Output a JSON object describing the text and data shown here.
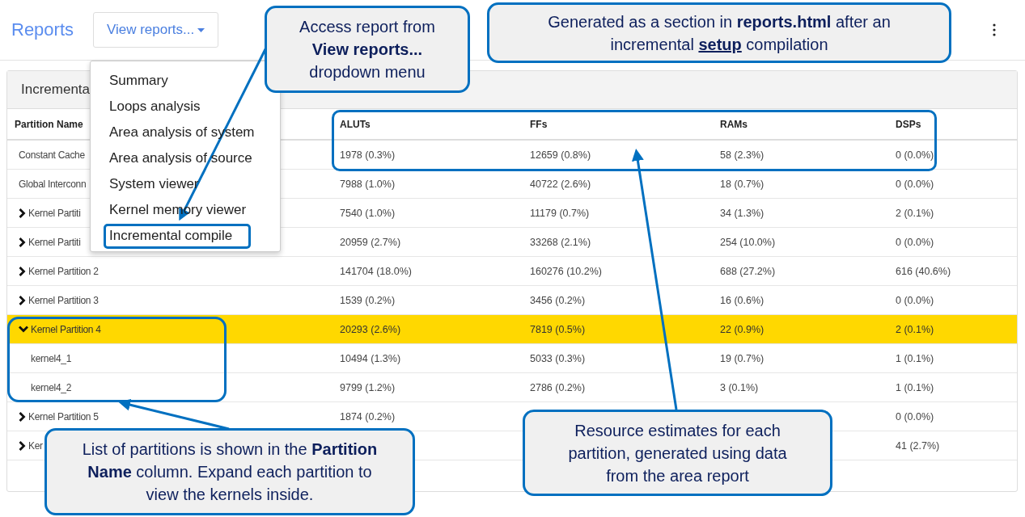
{
  "header": {
    "title": "Reports",
    "view_button": "View reports..."
  },
  "dropdown": {
    "items": [
      "Summary",
      "Loops analysis",
      "Area analysis of system",
      "Area analysis of source",
      "System viewer",
      "Kernel memory viewer",
      "Incremental compile"
    ]
  },
  "panel": {
    "title": "Incrementa",
    "columns": [
      "Partition Name",
      "ALUTs",
      "FFs",
      "RAMs",
      "DSPs"
    ],
    "rows": [
      {
        "kind": "plain",
        "cells": [
          "Constant Cache",
          "1978 (0.3%)",
          "12659 (0.8%)",
          "58 (2.3%)",
          "0 (0.0%)"
        ],
        "selected": false
      },
      {
        "kind": "plain",
        "cells": [
          "Global Interconn",
          "7988 (1.0%)",
          "40722 (2.6%)",
          "18 (0.7%)",
          "0 (0.0%)"
        ],
        "selected": false
      },
      {
        "kind": "partition",
        "expanded": false,
        "cells": [
          "Kernel Partiti",
          "7540 (1.0%)",
          "11179 (0.7%)",
          "34 (1.3%)",
          "2 (0.1%)"
        ],
        "selected": false
      },
      {
        "kind": "partition",
        "expanded": false,
        "cells": [
          "Kernel Partiti",
          "20959 (2.7%)",
          "33268 (2.1%)",
          "254 (10.0%)",
          "0 (0.0%)"
        ],
        "selected": false
      },
      {
        "kind": "partition",
        "expanded": false,
        "cells": [
          "Kernel Partition 2",
          "141704 (18.0%)",
          "160276 (10.2%)",
          "688 (27.2%)",
          "616 (40.6%)"
        ],
        "selected": false
      },
      {
        "kind": "partition",
        "expanded": false,
        "cells": [
          "Kernel Partition 3",
          "1539 (0.2%)",
          "3456 (0.2%)",
          "16 (0.6%)",
          "0 (0.0%)"
        ],
        "selected": false
      },
      {
        "kind": "partition",
        "expanded": true,
        "cells": [
          "Kernel Partition 4",
          "20293 (2.6%)",
          "7819 (0.5%)",
          "22 (0.9%)",
          "2 (0.1%)"
        ],
        "selected": true
      },
      {
        "kind": "kernel",
        "cells": [
          "kernel4_1",
          "10494 (1.3%)",
          "5033 (0.3%)",
          "19 (0.7%)",
          "1 (0.1%)"
        ],
        "selected": false
      },
      {
        "kind": "kernel",
        "cells": [
          "kernel4_2",
          "9799 (1.2%)",
          "2786 (0.2%)",
          "3 (0.1%)",
          "1 (0.1%)"
        ],
        "selected": false
      },
      {
        "kind": "partition",
        "expanded": false,
        "cells": [
          "Kernel Partition 5",
          "1874 (0.2%)",
          null,
          null,
          "0 (0.0%)"
        ],
        "selected": false
      },
      {
        "kind": "partition",
        "expanded": false,
        "cells": [
          "Ker",
          null,
          null,
          null,
          "41 (2.7%)"
        ],
        "selected": false
      }
    ]
  },
  "callouts": [
    {
      "parts": [
        {
          "kind": "plain",
          "text": "Access report from "
        },
        {
          "kind": "bold",
          "text": "View reports..."
        },
        {
          "kind": "plain",
          "text": " dropdown menu"
        }
      ]
    },
    {
      "parts": [
        {
          "kind": "plain",
          "text": "Generated as a section in "
        },
        {
          "kind": "bold",
          "text": "reports.html"
        },
        {
          "kind": "plain",
          "text": " after an incremental "
        },
        {
          "kind": "underlined",
          "text": "setup"
        },
        {
          "kind": "plain",
          "text": " compilation"
        }
      ]
    },
    {
      "parts": [
        {
          "kind": "plain",
          "text": "List of partitions is shown in the "
        },
        {
          "kind": "bold",
          "text": "Partition Name"
        },
        {
          "kind": "plain",
          "text": " column. Expand each partition to view the kernels inside."
        }
      ]
    },
    {
      "parts": [
        {
          "kind": "plain",
          "text": "Resource estimates for each partition, generated using data from the area report"
        }
      ]
    }
  ]
}
